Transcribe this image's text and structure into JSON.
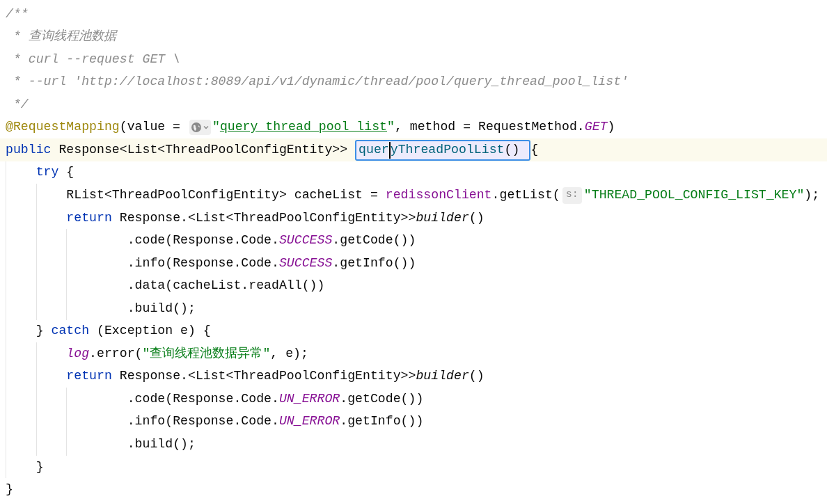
{
  "editor": {
    "lines": [
      {
        "current": false,
        "tokens": [
          {
            "text": "/**",
            "kind": "comment"
          }
        ]
      },
      {
        "current": false,
        "tokens": [
          {
            "text": " * 查询线程池数据",
            "kind": "comment"
          }
        ]
      },
      {
        "current": false,
        "tokens": [
          {
            "text": " * curl --request GET \\",
            "kind": "comment"
          }
        ]
      },
      {
        "current": false,
        "tokens": [
          {
            "text": " * --url 'http://localhost:8089/api/v1/dynamic/thread/pool/query_thread_pool_list'",
            "kind": "comment"
          }
        ]
      },
      {
        "current": false,
        "tokens": [
          {
            "text": " */",
            "kind": "comment"
          }
        ]
      },
      {
        "current": false,
        "tokens": [
          {
            "text": "@RequestMapping",
            "kind": "annotation"
          },
          {
            "text": "(value = ",
            "kind": "plain"
          },
          {
            "kind": "globe-hint"
          },
          {
            "text": "\"",
            "kind": "string"
          },
          {
            "text": "query_thread_pool_list",
            "kind": "url-string"
          },
          {
            "text": "\"",
            "kind": "string"
          },
          {
            "text": ", method = RequestMethod.",
            "kind": "plain"
          },
          {
            "text": "GET",
            "kind": "static"
          },
          {
            "text": ")",
            "kind": "plain"
          }
        ]
      },
      {
        "current": true,
        "tokens": [
          {
            "text": "public ",
            "kind": "keyword"
          },
          {
            "text": "Response<List<ThreadPoolConfigEntity>> ",
            "kind": "plain"
          },
          {
            "kind": "highlight",
            "parts": [
              {
                "text": "quer",
                "kind": "method-decl"
              },
              {
                "kind": "caret"
              },
              {
                "text": "yThreadPoolList",
                "kind": "method-decl"
              },
              {
                "text": "() ",
                "kind": "plain"
              }
            ]
          },
          {
            "text": "{",
            "kind": "plain"
          }
        ]
      },
      {
        "current": false,
        "tokens": [
          {
            "text": "    try ",
            "kind": "keyword"
          },
          {
            "text": "{",
            "kind": "plain"
          }
        ]
      },
      {
        "current": false,
        "tokens": [
          {
            "text": "        RList<ThreadPoolConfigEntity> cacheList = ",
            "kind": "plain"
          },
          {
            "text": "redissonClient",
            "kind": "field"
          },
          {
            "text": ".getList(",
            "kind": "plain"
          },
          {
            "kind": "param-hint",
            "text": "s:"
          },
          {
            "text": "\"THREAD_POOL_CONFIG_LIST_KEY\"",
            "kind": "string"
          },
          {
            "text": ");",
            "kind": "plain"
          }
        ]
      },
      {
        "current": false,
        "tokens": [
          {
            "text": "        return ",
            "kind": "keyword"
          },
          {
            "text": "Response.<List<ThreadPoolConfigEntity>>",
            "kind": "plain"
          },
          {
            "text": "builder",
            "kind": "italic"
          },
          {
            "text": "()",
            "kind": "plain"
          }
        ]
      },
      {
        "current": false,
        "tokens": [
          {
            "text": "                .code(Response.Code.",
            "kind": "plain"
          },
          {
            "text": "SUCCESS",
            "kind": "static"
          },
          {
            "text": ".getCode())",
            "kind": "plain"
          }
        ]
      },
      {
        "current": false,
        "tokens": [
          {
            "text": "                .info(Response.Code.",
            "kind": "plain"
          },
          {
            "text": "SUCCESS",
            "kind": "static"
          },
          {
            "text": ".getInfo())",
            "kind": "plain"
          }
        ]
      },
      {
        "current": false,
        "tokens": [
          {
            "text": "                .data(cacheList.readAll())",
            "kind": "plain"
          }
        ]
      },
      {
        "current": false,
        "tokens": [
          {
            "text": "                .build();",
            "kind": "plain"
          }
        ]
      },
      {
        "current": false,
        "tokens": [
          {
            "text": "    } ",
            "kind": "plain"
          },
          {
            "text": "catch ",
            "kind": "keyword"
          },
          {
            "text": "(Exception e) {",
            "kind": "plain"
          }
        ]
      },
      {
        "current": false,
        "tokens": [
          {
            "text": "        log",
            "kind": "static"
          },
          {
            "text": ".error(",
            "kind": "plain"
          },
          {
            "text": "\"查询线程池数据异常\"",
            "kind": "string"
          },
          {
            "text": ", e);",
            "kind": "plain"
          }
        ]
      },
      {
        "current": false,
        "tokens": [
          {
            "text": "        return ",
            "kind": "keyword"
          },
          {
            "text": "Response.<List<ThreadPoolConfigEntity>>",
            "kind": "plain"
          },
          {
            "text": "builder",
            "kind": "italic"
          },
          {
            "text": "()",
            "kind": "plain"
          }
        ]
      },
      {
        "current": false,
        "tokens": [
          {
            "text": "                .code(Response.Code.",
            "kind": "plain"
          },
          {
            "text": "UN_ERROR",
            "kind": "static"
          },
          {
            "text": ".getCode())",
            "kind": "plain"
          }
        ]
      },
      {
        "current": false,
        "tokens": [
          {
            "text": "                .info(Response.Code.",
            "kind": "plain"
          },
          {
            "text": "UN_ERROR",
            "kind": "static"
          },
          {
            "text": ".getInfo())",
            "kind": "plain"
          }
        ]
      },
      {
        "current": false,
        "tokens": [
          {
            "text": "                .build();",
            "kind": "plain"
          }
        ]
      },
      {
        "current": false,
        "tokens": [
          {
            "text": "    }",
            "kind": "plain"
          }
        ]
      },
      {
        "current": false,
        "tokens": [
          {
            "text": "}",
            "kind": "plain"
          }
        ]
      }
    ]
  }
}
